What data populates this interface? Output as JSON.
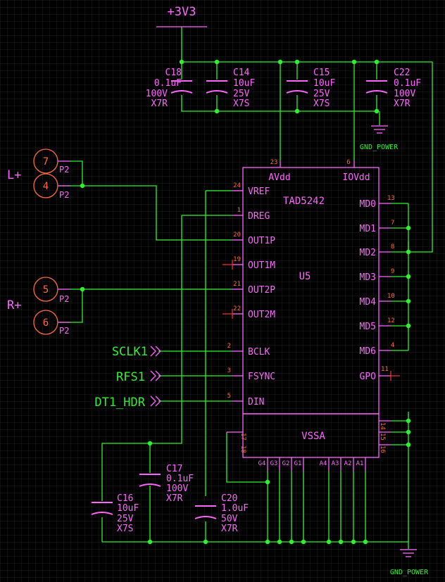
{
  "power": {
    "supply_label": "+3V3",
    "gnd_label": "GND_POWER"
  },
  "chip": {
    "name": "TAD5242",
    "ref": "U5",
    "top_pins": [
      {
        "num": "23",
        "label": "AVdd"
      },
      {
        "num": "6",
        "label": "IOVdd"
      }
    ],
    "left_pins": [
      {
        "num": "24",
        "label": "VREF"
      },
      {
        "num": "1",
        "label": "DREG"
      },
      {
        "num": "20",
        "label": "OUT1P"
      },
      {
        "num": "19",
        "label": "OUT1M"
      },
      {
        "num": "21",
        "label": "OUT2P"
      },
      {
        "num": "22",
        "label": "OUT2M"
      },
      {
        "num": "2",
        "label": "BCLK"
      },
      {
        "num": "3",
        "label": "FSYNC"
      },
      {
        "num": "5",
        "label": "DIN"
      }
    ],
    "right_pins": [
      {
        "num": "13",
        "label": "MD0"
      },
      {
        "num": "7",
        "label": "MD1"
      },
      {
        "num": "8",
        "label": "MD2"
      },
      {
        "num": "9",
        "label": "MD3"
      },
      {
        "num": "10",
        "label": "MD4"
      },
      {
        "num": "12",
        "label": "MD5"
      },
      {
        "num": "4",
        "label": "MD6"
      },
      {
        "num": "11",
        "label": "GPO"
      }
    ],
    "vssa": {
      "label": "VSSA",
      "left_nums": [
        "17",
        "18"
      ],
      "right_nums": [
        "14",
        "15",
        "16"
      ],
      "bottom_labels": [
        "G4",
        "G3",
        "G2",
        "G1",
        "A4",
        "A3",
        "A2",
        "A1"
      ]
    }
  },
  "top_caps": [
    {
      "ref": "C18",
      "value": "0.1uF",
      "voltage": "100V",
      "dielectric": "X7R"
    },
    {
      "ref": "C14",
      "value": "10uF",
      "voltage": "25V",
      "dielectric": "X7S"
    },
    {
      "ref": "C15",
      "value": "10uF",
      "voltage": "25V",
      "dielectric": "X7S"
    },
    {
      "ref": "C22",
      "value": "0.1uF",
      "voltage": "100V",
      "dielectric": "X7R"
    }
  ],
  "bottom_caps": [
    {
      "ref": "C17",
      "value": "0.1uF",
      "voltage": "100V",
      "dielectric": "X7R"
    },
    {
      "ref": "C16",
      "value": "10uF",
      "voltage": "25V",
      "dielectric": "X7S"
    },
    {
      "ref": "C20",
      "value": "1.0uF",
      "voltage": "50V",
      "dielectric": "X7R"
    }
  ],
  "connectors": {
    "left": {
      "net": "L+",
      "pins": [
        {
          "num": "7",
          "ref": "P2"
        },
        {
          "num": "4",
          "ref": "P2"
        }
      ]
    },
    "right": {
      "net": "R+",
      "pins": [
        {
          "num": "5",
          "ref": "P2"
        },
        {
          "num": "6",
          "ref": "P2"
        }
      ]
    }
  },
  "net_ports": [
    "SCLK1",
    "RFS1",
    "DT1_HDR"
  ],
  "colors": {
    "background": "#000000",
    "wire": "#2ef22e",
    "symbol": "#ff66ff",
    "pin_number": "#ff6b3d",
    "no_connect": "#ff3333",
    "grid": "#1e1e1e"
  }
}
